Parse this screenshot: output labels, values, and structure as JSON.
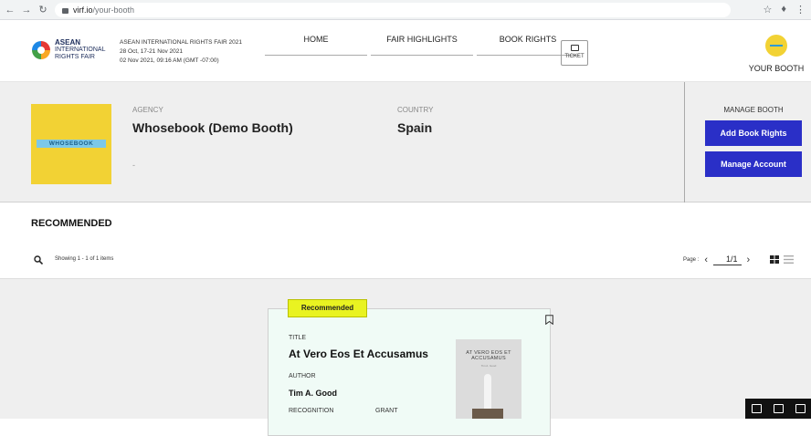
{
  "browser": {
    "url_host": "virf.io",
    "url_path": "/your-booth"
  },
  "header": {
    "logo_line1": "ASEAN",
    "logo_line2": "INTERNATIONAL",
    "logo_line3": "RIGHTS FAIR",
    "fair_name": "ASEAN INTERNATIONAL RIGHTS FAIR 2021",
    "fair_dates": "28 Oct, 17-21 Nov 2021",
    "current_time": "02 Nov 2021, 09:16 AM (GMT -07:00)",
    "nav": [
      "HOME",
      "FAIR HIGHLIGHTS",
      "BOOK RIGHTS"
    ],
    "ticket_label": "TICKET",
    "your_booth_label": "YOUR BOOTH"
  },
  "booth": {
    "logo_text": "WHOSEBOOK",
    "agency_label": "AGENCY",
    "agency_name": "Whosebook (Demo Booth)",
    "agency_desc": "-",
    "country_label": "COUNTRY",
    "country_name": "Spain",
    "manage_label": "MANAGE BOOTH",
    "add_rights_label": "Add Book Rights",
    "manage_account_label": "Manage Account"
  },
  "recommended": {
    "section_title": "RECOMMENDED",
    "showing_text": "Showing 1 - 1 of 1 items",
    "page_label": "Page :",
    "page_value": "1/1",
    "card": {
      "badge": "Recommended",
      "title_label": "TITLE",
      "title": "At Vero Eos Et Accusamus",
      "author_label": "AUTHOR",
      "author": "Tim A. Good",
      "recognition_label": "RECOGNITION",
      "grant_label": "GRANT",
      "cover_title": "AT VERO EOS ET ACCUSAMUS",
      "cover_author": "Tim A. Good"
    }
  },
  "colors": {
    "accent_blue": "#2a2fc7",
    "badge_yellow": "#e9f321",
    "brand_yellow": "#f2d234"
  }
}
